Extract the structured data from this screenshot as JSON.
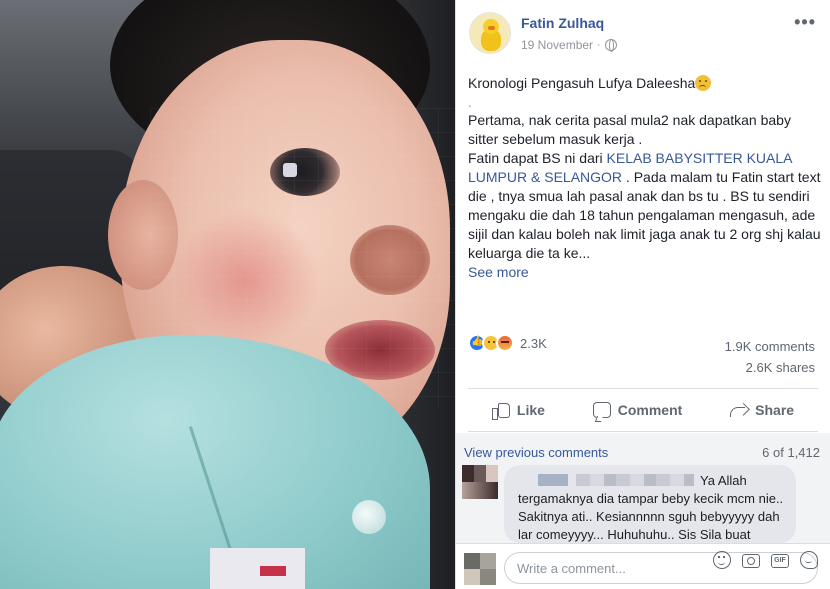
{
  "post": {
    "author": "Fatin Zulhaq",
    "date": "19 November",
    "separator": "·",
    "more_label": "•••",
    "title": "Kronologi Pengasuh Lufya Daleesha",
    "divider": ".",
    "para1": "Pertama, nak cerita pasal mula2 nak dapatkan baby sitter sebelum masuk kerja .",
    "para2_prefix": "Fatin dapat BS ni dari ",
    "para2_link": "KELAB BABYSITTER KUALA LUMPUR & SELANGOR",
    "para2_suffix": " . Pada malam tu Fatin start text die , tnya smua lah pasal anak dan bs tu . BS tu sendiri mengaku die dah 18 tahun pengalaman mengasuh, ade sijil dan kalau boleh nak limit jaga anak tu 2 org shj kalau keluarga die ta ke...",
    "see_more": "See more",
    "reaction_count": "2.3K",
    "comments_count": "1.9K comments",
    "shares_count": "2.6K shares",
    "actions": {
      "like": "Like",
      "comment": "Comment",
      "share": "Share"
    }
  },
  "comments": {
    "view_previous": "View previous comments",
    "count": "6 of 1,412",
    "items": [
      {
        "text": "Ya Allah tergamaknya dia tampar beby kecik mcm nie.. Sakitnya ati.. Kesiannnnn sguh bebyyyyy dah lar comeyyyy... Huhuhuhu.. Sis Sila buat police"
      }
    ],
    "write_placeholder": "Write a comment...",
    "gif_label": "GIF"
  },
  "icons": {
    "like": "thumbs-up-icon",
    "comment": "comment-bubble-icon",
    "share": "share-arrow-icon",
    "globe": "globe-icon",
    "emoji": "smile-icon",
    "camera": "camera-icon",
    "gif": "gif-icon",
    "sticker": "sticker-icon"
  },
  "colors": {
    "link": "#385898",
    "secondary_text": "#606770",
    "like_blue": "#2078f4",
    "comment_bg": "#f2f3f5"
  }
}
